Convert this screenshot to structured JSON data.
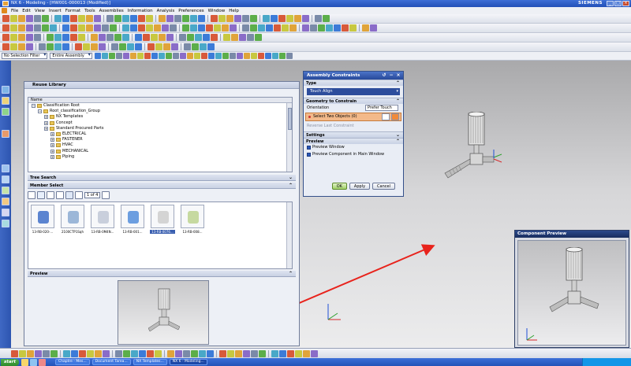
{
  "window": {
    "title": "NX 6 - Modeling - [HW001-000013 (Modified)]",
    "brand": "SIEMENS",
    "controls": [
      "minimize",
      "restore",
      "close"
    ]
  },
  "menubar": {
    "items": [
      "File",
      "Edit",
      "View",
      "Insert",
      "Format",
      "Tools",
      "Assemblies",
      "Information",
      "Analysis",
      "Preferences",
      "Window",
      "Help"
    ]
  },
  "selection_bar": {
    "filter": "No Selection Filter",
    "scope": "Entire Assembly"
  },
  "reuse_library": {
    "title": "Reuse Library",
    "tree_column": "Name",
    "tree_items": [
      {
        "label": "Classification Root",
        "level": 0
      },
      {
        "label": "Root_classification_Group",
        "level": 1
      },
      {
        "label": "NX Templates",
        "level": 2
      },
      {
        "label": "Concept",
        "level": 2
      },
      {
        "label": "Standard Procured Parts",
        "level": 2
      },
      {
        "label": "ELECTRICAL",
        "level": 3
      },
      {
        "label": "FASTENER",
        "level": 3
      },
      {
        "label": "HVAC",
        "level": 3
      },
      {
        "label": "MECHANICAL",
        "level": 3
      },
      {
        "label": "Piping",
        "level": 3
      }
    ],
    "tree_search_label": "Tree Search",
    "member_select_label": "Member Select",
    "page_info": "1 of 4",
    "members": [
      {
        "label": "13-RB-020-..."
      },
      {
        "label": "2100CTP1Sqh"
      },
      {
        "label": "13-RB-0M4N..."
      },
      {
        "label": "13-RB-001..."
      },
      {
        "label": "13-RB-0076...",
        "selected": true
      },
      {
        "label": "13-RB-008..."
      }
    ],
    "preview_label": "Preview"
  },
  "assembly_constraints": {
    "title": "Assembly Constraints",
    "type_label": "Type",
    "type_value": "Touch Align",
    "geometry_label": "Geometry to Constrain",
    "orientation_label": "Orientation",
    "orientation_value": "Prefer Touch",
    "select_objects": "Select Two Objects (0)",
    "reverse_label": "Reverse Last Constraint",
    "settings_label": "Settings",
    "preview_label": "Preview",
    "preview_window_check": "Preview Window",
    "preview_main_check": "Preview Component in Main Window",
    "buttons": {
      "ok": "OK",
      "apply": "Apply",
      "cancel": "Cancel"
    }
  },
  "component_preview": {
    "title": "Component Preview"
  },
  "taskbar": {
    "start": "start",
    "items": [
      {
        "label": "Chaptre - Mes...",
        "active": false
      },
      {
        "label": "Document Tarea...",
        "active": false
      },
      {
        "label": "NX Templates...",
        "active": false
      },
      {
        "label": "NX 6 - Modeling...",
        "active": true
      }
    ]
  },
  "colors": {
    "accent": "#2350b8",
    "dialog_title": "#27499a",
    "selection_highlight": "#f3b98a",
    "arrow": "#e8231c"
  }
}
